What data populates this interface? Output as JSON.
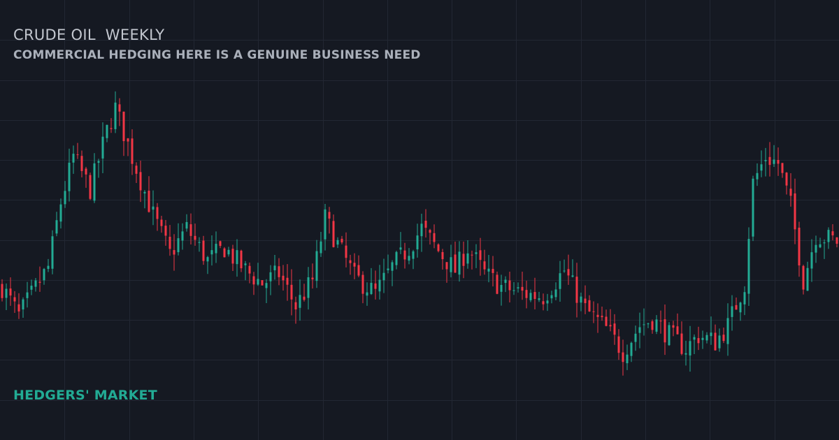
{
  "header": {
    "title": "CRUDE OIL  WEEKLY",
    "subtitle": "COMMERCIAL HEDGING HERE IS A GENUINE BUSINESS NEED"
  },
  "footer": {
    "label": "HEDGERS' MARKET"
  },
  "colors": {
    "background": "#151922",
    "grid": "#222733",
    "up": "#22ab94",
    "down": "#f23645"
  },
  "chart_data": {
    "type": "candlestick",
    "grid": true,
    "legend": "none",
    "ylim": [
      0,
      100
    ],
    "candle_count": 200,
    "close_path": [
      [
        0,
        30
      ],
      [
        4,
        21
      ],
      [
        11,
        36
      ],
      [
        14,
        56
      ],
      [
        17,
        70
      ],
      [
        21,
        60
      ],
      [
        25,
        78
      ],
      [
        27,
        85
      ],
      [
        31,
        70
      ],
      [
        36,
        52
      ],
      [
        40,
        40
      ],
      [
        44,
        48
      ],
      [
        49,
        38
      ],
      [
        53,
        42
      ],
      [
        58,
        35
      ],
      [
        62,
        31
      ],
      [
        66,
        34
      ],
      [
        70,
        24
      ],
      [
        74,
        32
      ],
      [
        77,
        51
      ],
      [
        80,
        43
      ],
      [
        84,
        33
      ],
      [
        89,
        28
      ],
      [
        93,
        36
      ],
      [
        97,
        42
      ],
      [
        100,
        48
      ],
      [
        104,
        41
      ],
      [
        108,
        35
      ],
      [
        111,
        42
      ],
      [
        115,
        34
      ],
      [
        119,
        30
      ],
      [
        124,
        28
      ],
      [
        129,
        27
      ],
      [
        134,
        35
      ],
      [
        139,
        23
      ],
      [
        144,
        17
      ],
      [
        148,
        10
      ],
      [
        152,
        18
      ],
      [
        155,
        20
      ],
      [
        159,
        15
      ],
      [
        163,
        11
      ],
      [
        166,
        15
      ],
      [
        170,
        13
      ],
      [
        173,
        18
      ],
      [
        177,
        31
      ],
      [
        179,
        62
      ],
      [
        182,
        70
      ],
      [
        185,
        68
      ],
      [
        188,
        55
      ],
      [
        191,
        32
      ],
      [
        194,
        46
      ],
      [
        199,
        44
      ]
    ]
  }
}
